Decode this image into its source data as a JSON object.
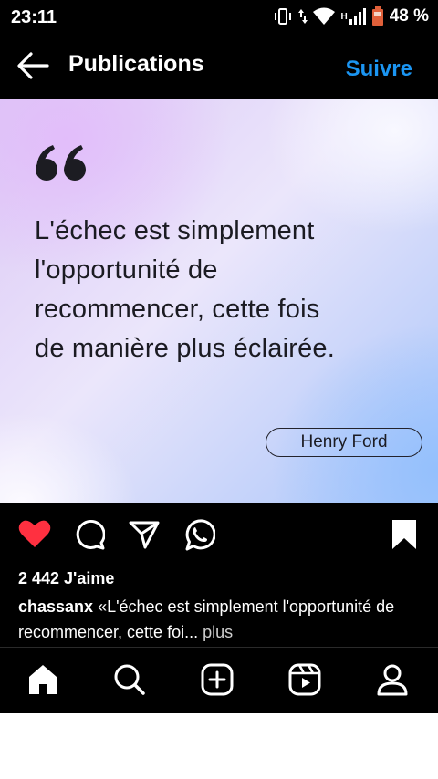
{
  "status_bar": {
    "time": "23:11",
    "network": "H",
    "battery": "48 %",
    "icons": [
      "vibrate-icon",
      "data-arrows-icon",
      "wifi-icon",
      "signal-icon",
      "battery-icon"
    ]
  },
  "header": {
    "back_icon": "arrow-left-icon",
    "title": "Publications",
    "follow_label": "Suivre",
    "follow_color": "#1b95f2"
  },
  "post": {
    "quote_icon": "quote-mark-icon",
    "quote_lines": [
      "L'échec est simplement",
      "l'opportunité de",
      "recommencer, cette fois",
      "de manière plus éclairée."
    ],
    "author": "Henry Ford"
  },
  "actions": {
    "like_icon": "heart-filled-icon",
    "like_color": "#ff3040",
    "comment_icon": "comment-icon",
    "share_icon": "send-icon",
    "whatsapp_icon": "whatsapp-icon",
    "save_icon": "bookmark-filled-icon"
  },
  "likes": {
    "count_text": "2 442 J'aime"
  },
  "caption": {
    "username": "chassanx",
    "text": " «L'échec est simplement l'opportunité de recommencer, cette foi...",
    "more": " plus"
  },
  "bottom_nav": {
    "items": [
      "home-icon",
      "search-icon",
      "add-post-icon",
      "reels-icon",
      "profile-icon"
    ]
  }
}
